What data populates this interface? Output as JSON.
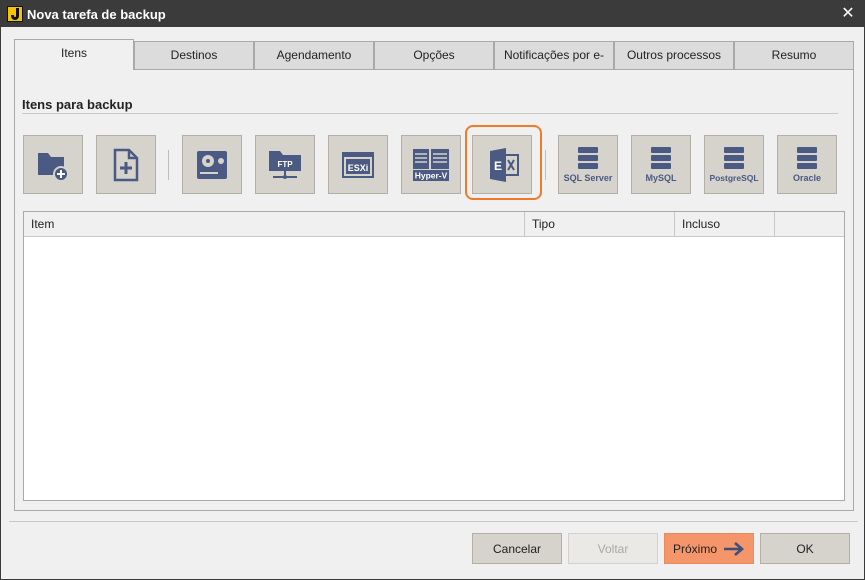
{
  "window": {
    "title": "Nova tarefa de backup"
  },
  "tabs": [
    {
      "label": "Itens",
      "active": true
    },
    {
      "label": "Destinos",
      "active": false
    },
    {
      "label": "Agendamento",
      "active": false
    },
    {
      "label": "Opções",
      "active": false
    },
    {
      "label": "Notificações por e-mail",
      "active": false
    },
    {
      "label": "Outros processos",
      "active": false
    },
    {
      "label": "Resumo",
      "active": false
    }
  ],
  "section": {
    "title": "Itens para backup"
  },
  "toolbar": {
    "items": [
      {
        "icon": "folder-add-icon"
      },
      {
        "icon": "file-add-icon"
      },
      {
        "icon": "disk-icon"
      },
      {
        "icon": "ftp-folder-icon",
        "label": "FTP"
      },
      {
        "icon": "esxi-icon",
        "label": "ESXi"
      },
      {
        "icon": "hyper-v-icon",
        "label": "Hyper-V"
      },
      {
        "icon": "exchange-icon",
        "label": "E",
        "highlighted": true
      },
      {
        "icon": "database-icon",
        "label": "SQL Server"
      },
      {
        "icon": "database-icon",
        "label": "MySQL"
      },
      {
        "icon": "database-icon",
        "label": "PostgreSQL"
      },
      {
        "icon": "database-icon",
        "label": "Oracle"
      }
    ]
  },
  "table": {
    "columns": [
      "Item",
      "Tipo",
      "Incluso",
      ""
    ],
    "rows": []
  },
  "buttons": {
    "cancel": "Cancelar",
    "back": "Voltar",
    "next": "Próximo",
    "ok": "OK"
  },
  "colors": {
    "titlebar": "#3b3b3b",
    "icon_fill": "#4a5a82",
    "highlight": "#ee7a2a",
    "primary": "#f4956a"
  }
}
